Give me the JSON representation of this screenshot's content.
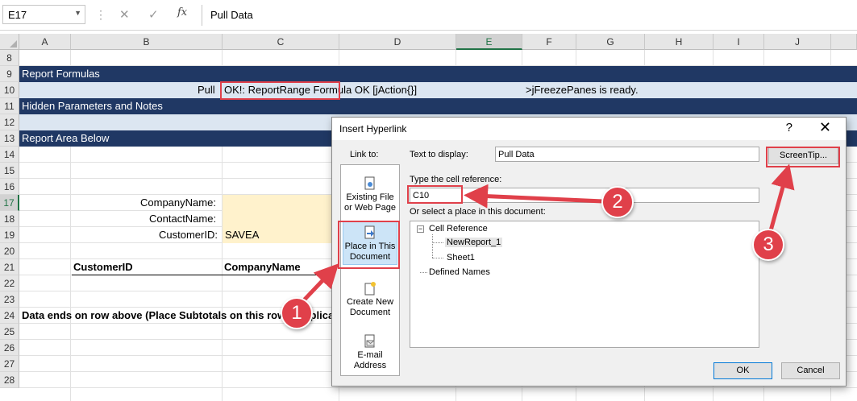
{
  "formula_bar": {
    "name_box": "E17",
    "formula": "Pull Data"
  },
  "columns": [
    "A",
    "B",
    "C",
    "D",
    "E",
    "F",
    "G",
    "H",
    "I",
    "J"
  ],
  "selected_column": "E",
  "rows": [
    "8",
    "9",
    "10",
    "11",
    "12",
    "13",
    "14",
    "15",
    "16",
    "17",
    "18",
    "19",
    "20",
    "21",
    "22",
    "23",
    "24",
    "25",
    "26",
    "27",
    "28"
  ],
  "selected_row": "17",
  "sheet": {
    "row9_band": "Report Formulas",
    "row10_left": "Pull ",
    "row10_formula": "OK!: ReportRange Formula OK [jAction{}]",
    "row10_right": ">jFreezePanes is ready.",
    "row11_band": "Hidden Parameters and Notes",
    "row13_band": "Report Area Below",
    "label_company": "CompanyName:",
    "label_contact": "ContactName:",
    "label_customerid": "CustomerID:",
    "customerid_value": "SAVEA",
    "header_customerid": "CustomerID",
    "header_companyname": "CompanyName",
    "row24_text": "Data ends on row above (Place Subtotals on this row if applicab"
  },
  "dialog": {
    "title": "Insert Hyperlink",
    "help": "?",
    "close": "✕",
    "link_to_label": "Link to:",
    "text_to_display_label": "Text to display:",
    "text_to_display_value": "Pull Data",
    "screentip_button": "ScreenTip...",
    "cell_reference_label": "Type the cell reference:",
    "cell_reference_value": "C10",
    "place_label": "Or select a place in this document:",
    "link_options": [
      {
        "line1": "Existing File",
        "line2": "or Web Page"
      },
      {
        "line1": "Place in This",
        "line2": "Document"
      },
      {
        "line1": "Create New",
        "line2": "Document"
      },
      {
        "line1": "E-mail",
        "line2": "Address"
      }
    ],
    "tree": {
      "cell_reference": "Cell Reference",
      "children": [
        "NewReport_1",
        "Sheet1"
      ],
      "defined_names": "Defined Names"
    },
    "ok_button": "OK",
    "cancel_button": "Cancel"
  },
  "annotations": [
    "1",
    "2",
    "3"
  ],
  "colors": {
    "header_band": "#203864",
    "light_band": "#dce6f1",
    "input_fill": "#fff2cc",
    "annotation_red": "#e0404a",
    "excel_green": "#217346"
  }
}
